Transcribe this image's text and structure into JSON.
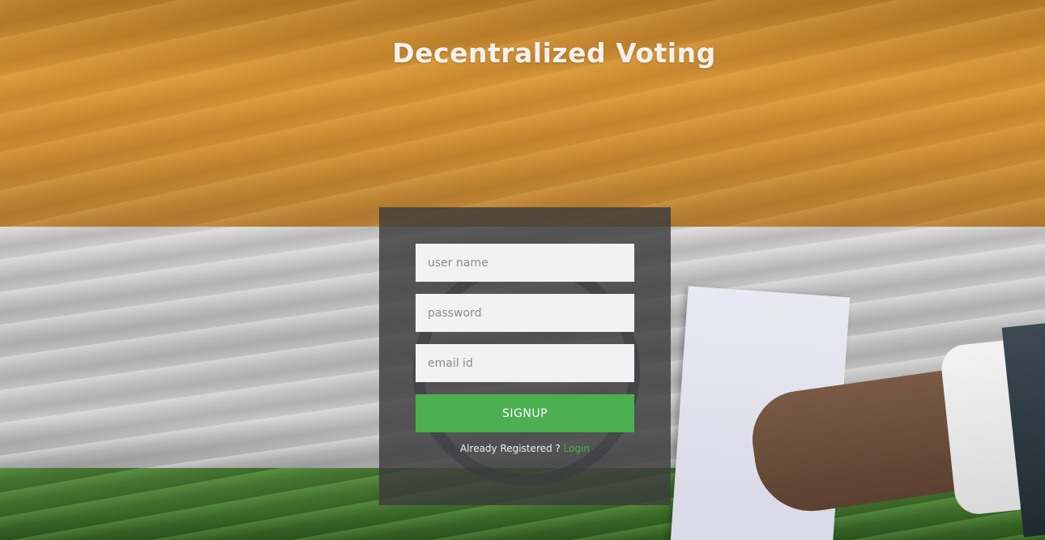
{
  "header": {
    "title": "Decentralized Voting"
  },
  "form": {
    "username_placeholder": "user name",
    "password_placeholder": "password",
    "email_placeholder": "email id",
    "signup_label": "SIGNUP",
    "already_registered_text": "Already Registered ?",
    "login_link_label": "Login"
  },
  "colors": {
    "accent": "#4caf50",
    "panel": "#3c3c3c"
  }
}
